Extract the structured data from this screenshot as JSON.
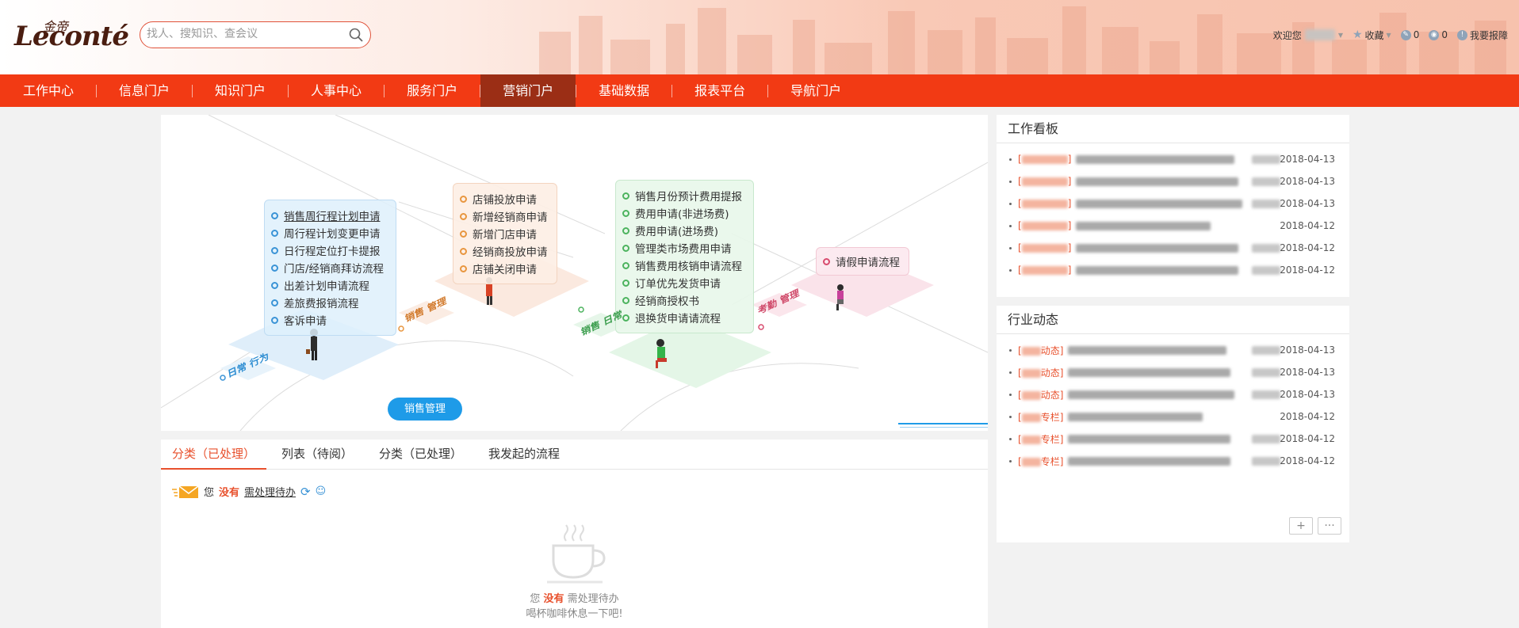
{
  "header": {
    "logo_text": "Leconté",
    "logo_cn": "金帝",
    "search_placeholder": "找人、搜知识、查会议",
    "welcome": "欢迎您",
    "favorites": "收藏",
    "count1": "0",
    "count2": "0",
    "report": "我要报障"
  },
  "nav": [
    "工作中心",
    "信息门户",
    "知识门户",
    "人事中心",
    "服务门户",
    "营销门户",
    "基础数据",
    "报表平台",
    "导航门户"
  ],
  "nav_active": "营销门户",
  "banner": {
    "blue_items": [
      "销售周行程计划申请",
      "周行程计划变更申请",
      "日行程定位打卡提报",
      "门店/经销商拜访流程",
      "出差计划申请流程",
      "差旅费报销流程",
      "客诉申请"
    ],
    "orange_items": [
      "店铺投放申请",
      "新增经销商申请",
      "新增门店申请",
      "经销商投放申请",
      "店铺关闭申请"
    ],
    "green_items": [
      "销售月份预计费用提报",
      "费用申请(非进场费)",
      "费用申请(进场费)",
      "管理类市场费用申请",
      "销售费用核销申请流程",
      "订单优先发货申请",
      "经销商授权书",
      "退换货申请请流程"
    ],
    "pink_items": [
      "请假申请流程"
    ],
    "labels": {
      "daily": "日常 行为",
      "sales_mgmt": "销售 管理",
      "sales_daily": "销售 日常",
      "attendance": "考勤 管理"
    },
    "button": "销售管理"
  },
  "tabs": [
    "分类（已处理）",
    "列表（待阅）",
    "分类（已处理）",
    "我发起的流程"
  ],
  "todo": {
    "you": "您",
    "none": "没有",
    "pending": "需处理待办",
    "empty_line2": "喝杯咖啡休息一下吧!"
  },
  "work_board": {
    "title": "工作看板",
    "dates": [
      "2018-04-13",
      "2018-04-13",
      "2018-04-13",
      "2018-04-12",
      "2018-04-12",
      "2018-04-12"
    ]
  },
  "industry": {
    "title": "行业动态",
    "tags": [
      "动态",
      "动态",
      "动态",
      "专栏",
      "专栏",
      "专栏"
    ],
    "dates": [
      "2018-04-13",
      "2018-04-13",
      "2018-04-13",
      "2018-04-12",
      "2018-04-12",
      "2018-04-12"
    ],
    "btn_add": "+",
    "btn_more": "···"
  },
  "colors": {
    "nav": "#f23a14",
    "nav_active": "#9b2e15",
    "accent": "#e8502c",
    "button_blue": "#1e9be8"
  }
}
